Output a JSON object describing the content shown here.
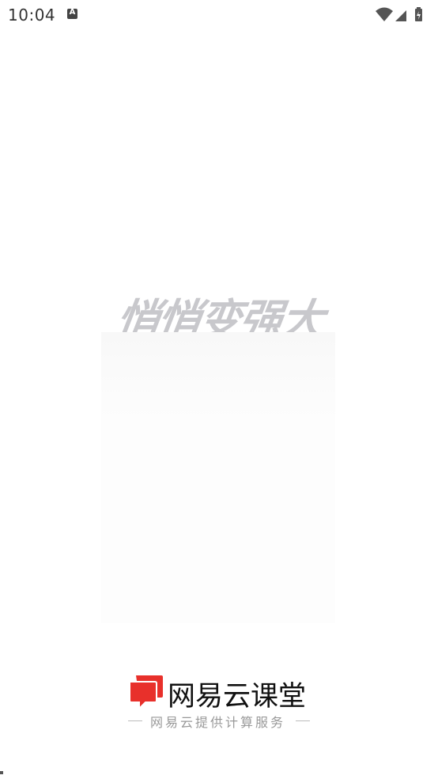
{
  "status_bar": {
    "time": "10:04",
    "notification_icon": "a-icon",
    "wifi_icon": "wifi-icon",
    "signal_icon": "signal-icon",
    "battery_icon": "battery-charging-icon"
  },
  "splash": {
    "slogan": "悄悄变强大"
  },
  "brand": {
    "logo_icon": "chat-bubble-logo-icon",
    "logo_color": "#e8302b",
    "name": "网易云课堂",
    "tagline": "网易云提供计算服务"
  }
}
